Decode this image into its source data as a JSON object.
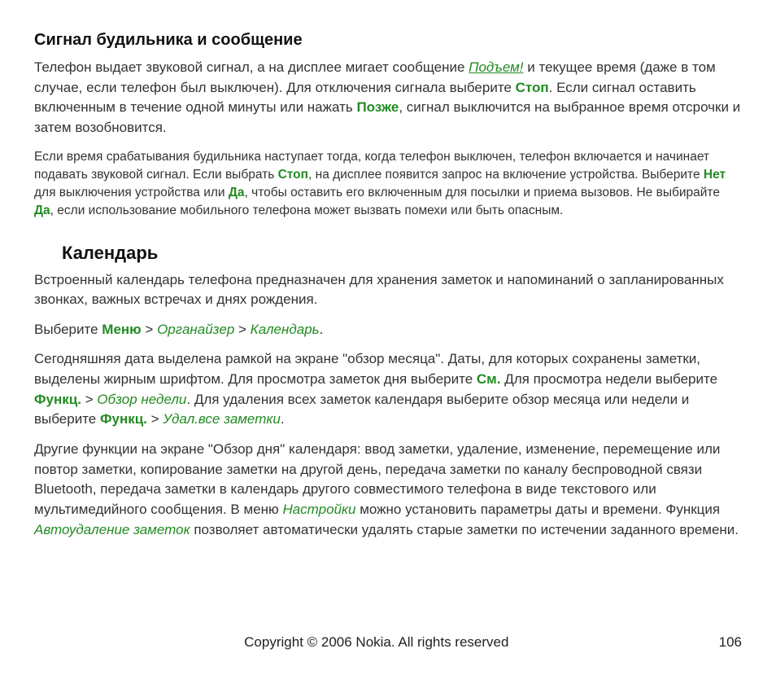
{
  "section1": {
    "heading": "Сигнал будильника и сообщение",
    "p1a": "Телефон выдает звуковой сигнал, а на дисплее мигает сообщение ",
    "p1_podyem": "Подъем!",
    "p1b": " и текущее время (даже в том случае, если телефон был выключен). Для отключения сигнала выберите ",
    "p1_stop": "Стоп",
    "p1c": ". Если сигнал оставить включенным в течение одной минуты или нажать ",
    "p1_pozhe": "Позже",
    "p1d": ", сигнал выключится на выбранное время отсрочки и затем возобновится.",
    "p2a": "Если время срабатывания будильника наступает тогда, когда телефон выключен, телефон включается и начинает подавать звуковой сигнал. Если выбрать ",
    "p2_stop": "Стоп",
    "p2b": ", на дисплее появится запрос на включение устройства. Выберите ",
    "p2_net": "Нет",
    "p2c": " для выключения устройства или ",
    "p2_da1": "Да",
    "p2d": ", чтобы оставить его включенным для посылки и приема вызовов. Не выбирайте ",
    "p2_da2": "Да",
    "p2e": ", если использование мобильного телефона может вызвать помехи или быть опасным."
  },
  "section2": {
    "heading": "Календарь",
    "p1": "Встроенный календарь телефона предназначен для хранения заметок и напоминаний о запланированных звонках, важных встречах и днях рождения.",
    "p2a": "Выберите ",
    "p2_menu": "Меню",
    "p2_sep1": " > ",
    "p2_org": "Органайзер",
    "p2_sep2": " > ",
    "p2_cal": "Календарь",
    "p2_end": ".",
    "p3a": "Сегодняшняя дата выделена рамкой на экране \"обзор месяца\". Даты, для которых сохранены заметки, выделены жирным шрифтом. Для просмотра заметок дня выберите ",
    "p3_sm": "См.",
    "p3b": " Для просмотра недели выберите ",
    "p3_funk1": "Функц.",
    "p3_sep1": " > ",
    "p3_obzor": "Обзор недели",
    "p3c": ". Для удаления всех заметок календаря выберите обзор месяца или недели и выберите ",
    "p3_funk2": "Функц.",
    "p3_sep2": " > ",
    "p3_udal": "Удал.все заметки",
    "p3_end": ".",
    "p4a": "Другие функции на экране \"Обзор дня\" календаря: ввод заметки, удаление, изменение, перемещение или повтор заметки, копирование заметки на другой день, передача заметки по каналу беспроводной связи Bluetooth, передача заметки в календарь другого совместимого телефона в виде текстового или мультимедийного сообщения. В меню ",
    "p4_nastr": "Настройки",
    "p4b": " можно установить параметры даты и времени. Функция ",
    "p4_auto": "Автоудаление заметок",
    "p4c": " позволяет автоматически удалять старые заметки по истечении заданного времени."
  },
  "footer": {
    "copyright": "Copyright © 2006 Nokia. All rights reserved",
    "page": "106"
  }
}
